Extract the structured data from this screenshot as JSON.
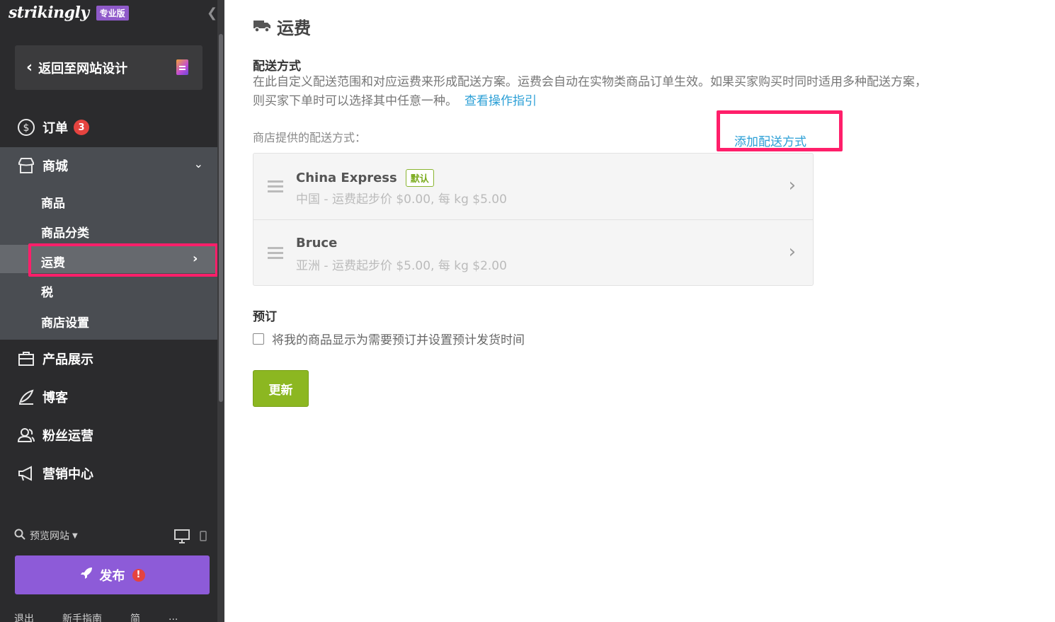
{
  "sidebar": {
    "logo": "strikingly",
    "plan_badge": "专业版",
    "collapse_icon": "chevron-left-icon",
    "back_button": "返回至网站设计",
    "nav": {
      "orders": {
        "label": "订单",
        "badge": "3",
        "icon": "dollar-circle-icon"
      },
      "store": {
        "label": "商城",
        "icon": "store-icon"
      },
      "showcase": {
        "label": "产品展示",
        "icon": "briefcase-icon"
      },
      "blog": {
        "label": "博客",
        "icon": "quill-icon"
      },
      "fans": {
        "label": "粉丝运营",
        "icon": "users-icon"
      },
      "marketing": {
        "label": "营销中心",
        "icon": "megaphone-icon"
      }
    },
    "store_sub": [
      "商品",
      "商品分类",
      "运费",
      "税",
      "商店设置"
    ],
    "preview": "预览网站",
    "publish": "发布",
    "publish_warning": "!",
    "footer": [
      "退出",
      "新手指南",
      "简",
      "..."
    ]
  },
  "main": {
    "title": "运费",
    "shipping_section_title": "配送方式",
    "description": "在此自定义配送范围和对应运费来形成配送方案。运费会自动在实物类商品订单生效。如果买家购买时同时适用多种配送方案，则买家下单时可以选择其中任意一种。",
    "guide_link": "查看操作指引",
    "list_label": "商店提供的配送方式：",
    "add_link": "添加配送方式",
    "methods": [
      {
        "name": "China Express",
        "tag": "默认",
        "desc": "中国 - 运费起步价 $0.00, 每 kg $5.00"
      },
      {
        "name": "Bruce",
        "tag": "",
        "desc": "亚洲 - 运费起步价 $5.00, 每 kg $2.00"
      }
    ],
    "preorder_title": "预订",
    "preorder_checkbox": "将我的商品显示为需要预订并设置预计发货时间",
    "update_button": "更新"
  },
  "colors": {
    "sidebar_bg": "#2b2b2d",
    "highlight": "#ff1f6a",
    "publish": "#8d5bd8",
    "update": "#8cb721",
    "link": "#2b9fd6"
  }
}
